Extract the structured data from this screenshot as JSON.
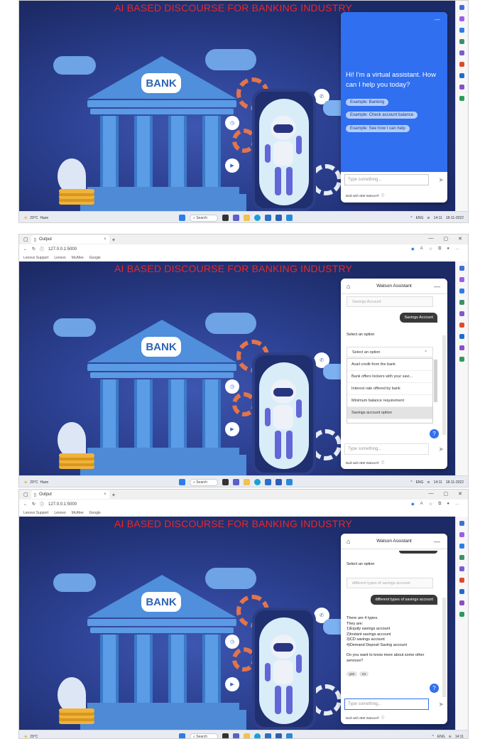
{
  "page_title": "AI BASED DISCOURSE FOR BANKING INDUSTRY",
  "scene": {
    "bank_sign": "BANK"
  },
  "browser": {
    "tab_label": "Output",
    "tab_close": "×",
    "new_tab": "+",
    "url": "127.0.0.1:5000",
    "bookmarks": [
      "Lenovo Support",
      "Lenovo",
      "McAfee",
      "Google"
    ]
  },
  "taskbar": {
    "weather_temp": "29°C",
    "weather_desc": "Haze",
    "search_label": "Search",
    "lang": "ENG",
    "region": "IN",
    "time1": "14:11",
    "time2": "14:11",
    "time3": "14:11",
    "date": "18-11-2022"
  },
  "chat1": {
    "greeting": "Hi! I'm a virtual assistant. How can I help you today?",
    "examples": [
      "Example: Banking",
      "Example: Check account balance",
      "Example: See how I can help"
    ],
    "input_placeholder": "Type something...",
    "built_with": "Built with IBM Watson®"
  },
  "chat2": {
    "header": "Watson Assistant",
    "prev_select": "Savings Account",
    "user_msg": "Savings Account",
    "prompt": "Select an option",
    "select_placeholder": "Select an option",
    "options": [
      "Avail credit from the bank",
      "Bank offers lockers with your savi...",
      "Interest rate offered by bank",
      "Minimum balance requirement",
      "Savings account option"
    ],
    "input_placeholder": "Type something...",
    "built_with": "Built with IBM Watson®"
  },
  "chat3": {
    "header": "Watson Assistant",
    "prompt": "Select an option",
    "prev_select": "different types of savings account",
    "user_msg": "different types of savings account",
    "answer_lines": [
      "There are 4 types.",
      "They are:",
      "1)Equity savings account",
      "2)Instant savings account",
      "3)CD savings account",
      "4)Demand Deposit Saving account"
    ],
    "followup_lines": [
      "Do you want to know more about some other",
      "services?"
    ],
    "chips": [
      "yes",
      "no"
    ],
    "input_placeholder": "Type something...",
    "built_with": "Built with IBM Watson®"
  }
}
